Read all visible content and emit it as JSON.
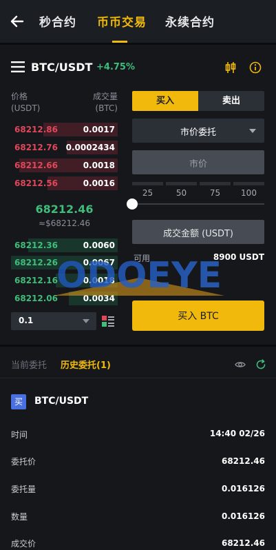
{
  "nav": {
    "tabs": [
      "秒合约",
      "币币交易",
      "永续合约"
    ],
    "active_index": 1
  },
  "pair": {
    "symbol": "BTC/USDT",
    "change": "+4.75%"
  },
  "orderbook": {
    "price_header": [
      "价格",
      "(USDT)"
    ],
    "qty_header": [
      "成交量",
      "(BTC)"
    ],
    "asks": [
      {
        "price": "68212.86",
        "qty": "0.0017",
        "depth": 0.7
      },
      {
        "price": "68212.76",
        "qty": "0.0002434",
        "depth": 0.48
      },
      {
        "price": "68212.66",
        "qty": "0.0018",
        "depth": 0.92
      },
      {
        "price": "68212.56",
        "qty": "0.0016",
        "depth": 0.66
      }
    ],
    "mid_price": "68212.46",
    "mid_price_sub": "≈$68212.46",
    "bids": [
      {
        "price": "68212.36",
        "qty": "0.0060",
        "depth": 0.84
      },
      {
        "price": "68212.26",
        "qty": "0.0067",
        "depth": 1.0
      },
      {
        "price": "68212.16",
        "qty": "0.0018",
        "depth": 0.58
      },
      {
        "price": "68212.06",
        "qty": "0.0034",
        "depth": 0.46
      }
    ],
    "depth_value": "0.1"
  },
  "form": {
    "buy_tab": "买入",
    "sell_tab": "卖出",
    "order_type": "市价委托",
    "price_placeholder": "市价",
    "percentages": [
      "25",
      "50",
      "75",
      "100"
    ],
    "slider_value": 0,
    "amount_label": "成交金额 (USDT)",
    "available_label": "可用",
    "available_value": "8900 USDT",
    "submit_label": "买入 BTC"
  },
  "watermark": {
    "text": "ODOEYE"
  },
  "orders": {
    "tabs": [
      "当前委托",
      "历史委托(1)"
    ],
    "active_index": 1,
    "item": {
      "side_badge": "买",
      "pair": "BTC/USDT",
      "details": [
        {
          "label": "时间",
          "value": "14:40 02/26"
        },
        {
          "label": "委托价",
          "value": "68212.46"
        },
        {
          "label": "委托量",
          "value": "0.016126"
        },
        {
          "label": "数量",
          "value": "0.016126"
        },
        {
          "label": "成交价",
          "value": "68212.46"
        }
      ]
    }
  },
  "colors": {
    "accent": "#f0b90b",
    "up": "#3fbd7a",
    "down": "#e1475a",
    "badge": "#4a6fe0"
  }
}
